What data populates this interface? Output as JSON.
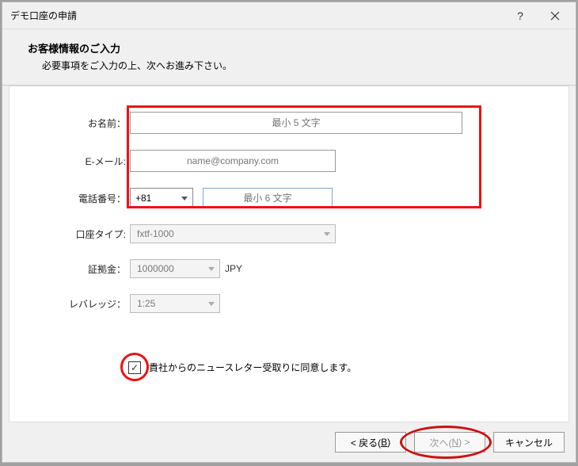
{
  "window": {
    "title": "デモ口座の申請"
  },
  "header": {
    "title": "お客様情報のご入力",
    "subtitle": "必要事項をご入力の上、次へお進み下さい。"
  },
  "form": {
    "name": {
      "label": "お名前：",
      "placeholder": "最小 5 文字"
    },
    "email": {
      "label": "E-メール:",
      "placeholder": "name@company.com"
    },
    "phone": {
      "label": "電話番号：",
      "country_code": "+81",
      "placeholder": "最小 6 文字"
    },
    "account_type": {
      "label": "口座タイプ:",
      "value": "fxtf-1000"
    },
    "deposit": {
      "label": "証拠金：",
      "value": "1000000",
      "currency": "JPY"
    },
    "leverage": {
      "label": "レバレッジ：",
      "value": "1:25"
    },
    "newsletter": {
      "label": "貴社からのニュースレター受取りに同意します。",
      "checked": "✓"
    }
  },
  "footer": {
    "back": {
      "prefix": "< 戻る(",
      "key": "B",
      "suffix": ")"
    },
    "next": {
      "prefix": "次へ(",
      "key": "N",
      "suffix": ") >"
    },
    "cancel": "キャンセル"
  }
}
